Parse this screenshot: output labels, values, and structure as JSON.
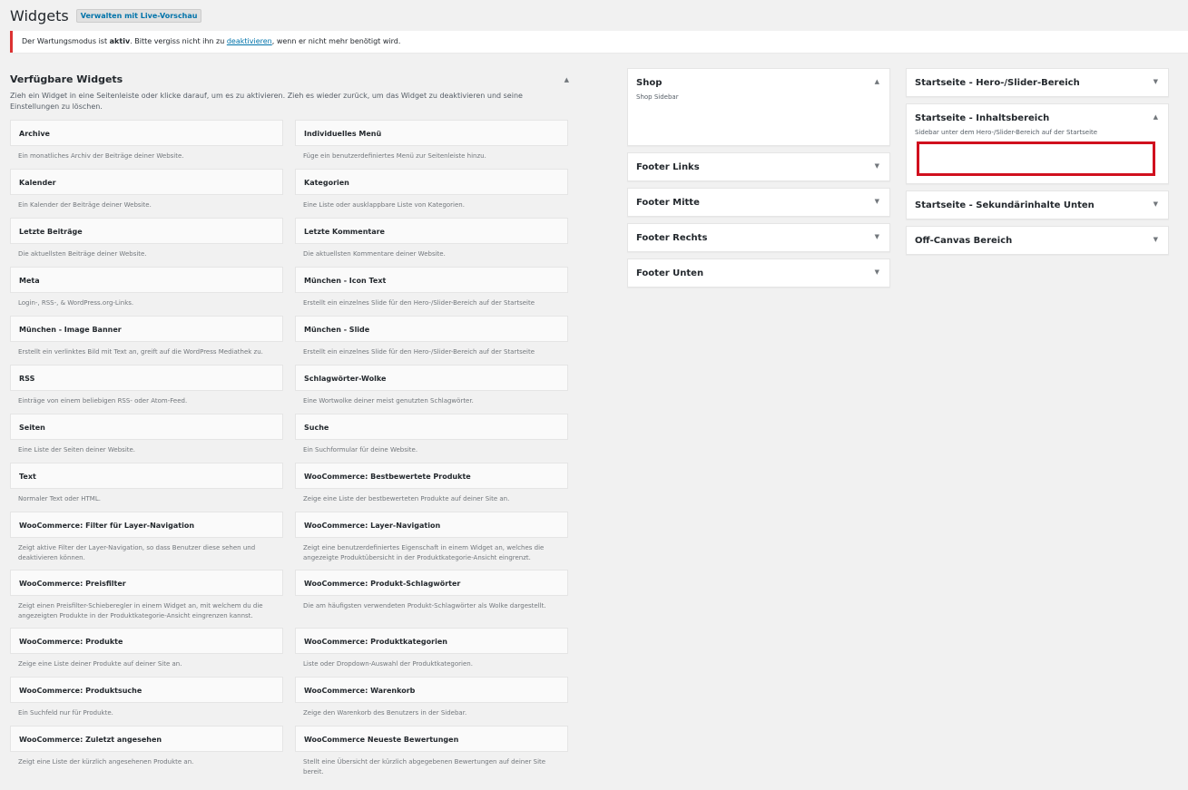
{
  "header": {
    "title": "Widgets",
    "live_preview": "Verwalten mit Live-Vorschau"
  },
  "notice": {
    "before": "Der Wartungsmodus ist ",
    "bold": "aktiv",
    "middle": ". Bitte vergiss nicht ihn zu ",
    "link": "deaktivieren",
    "after": ", wenn er nicht mehr benötigt wird."
  },
  "available": {
    "title": "Verfügbare Widgets",
    "toggle": "▲",
    "desc": "Zieh ein Widget in eine Seitenleiste oder klicke darauf, um es zu aktivieren. Zieh es wieder zurück, um das Widget zu deaktivieren und seine Einstellungen zu löschen.",
    "widgets": [
      {
        "title": "Archive",
        "desc": "Ein monatliches Archiv der Beiträge deiner Website."
      },
      {
        "title": "Individuelles Menü",
        "desc": "Füge ein benutzerdefiniertes Menü zur Seitenleiste hinzu."
      },
      {
        "title": "Kalender",
        "desc": "Ein Kalender der Beiträge deiner Website."
      },
      {
        "title": "Kategorien",
        "desc": "Eine Liste oder ausklappbare Liste von Kategorien."
      },
      {
        "title": "Letzte Beiträge",
        "desc": "Die aktuellsten Beiträge deiner Website."
      },
      {
        "title": "Letzte Kommentare",
        "desc": "Die aktuellsten Kommentare deiner Website."
      },
      {
        "title": "Meta",
        "desc": "Login-, RSS-, & WordPress.org-Links."
      },
      {
        "title": "München - Icon Text",
        "desc": "Erstellt ein einzelnes Slide für den Hero-/Slider-Bereich auf der Startseite"
      },
      {
        "title": "München - Image Banner",
        "desc": "Erstellt ein verlinktes Bild mit Text an, greift auf die WordPress Mediathek zu."
      },
      {
        "title": "München - Slide",
        "desc": "Erstellt ein einzelnes Slide für den Hero-/Slider-Bereich auf der Startseite"
      },
      {
        "title": "RSS",
        "desc": "Einträge von einem beliebigen RSS- oder Atom-Feed."
      },
      {
        "title": "Schlagwörter-Wolke",
        "desc": "Eine Wortwolke deiner meist genutzten Schlagwörter."
      },
      {
        "title": "Seiten",
        "desc": "Eine Liste der Seiten deiner Website."
      },
      {
        "title": "Suche",
        "desc": "Ein Suchformular für deine Website."
      },
      {
        "title": "Text",
        "desc": "Normaler Text oder HTML."
      },
      {
        "title": "WooCommerce: Bestbewertete Produkte",
        "desc": "Zeige eine Liste der bestbewerteten Produkte auf deiner Site an."
      },
      {
        "title": "WooCommerce: Filter für Layer-Navigation",
        "desc": "Zeigt aktive Filter der Layer-Navigation, so dass Benutzer diese sehen und deaktivieren können."
      },
      {
        "title": "WooCommerce: Layer-Navigation",
        "desc": "Zeigt eine benutzerdefiniertes Eigenschaft in einem Widget an, welches die angezeigte Produktübersicht in der Produktkategorie-Ansicht eingrenzt."
      },
      {
        "title": "WooCommerce: Preisfilter",
        "desc": "Zeigt einen Preisfilter-Schieberegler in einem Widget an, mit welchem du die angezeigten Produkte in der Produktkategorie-Ansicht eingrenzen kannst."
      },
      {
        "title": "WooCommerce: Produkt-Schlagwörter",
        "desc": "Die am häufigsten verwendeten Produkt-Schlagwörter als Wolke dargestellt."
      },
      {
        "title": "WooCommerce: Produkte",
        "desc": "Zeige eine Liste deiner Produkte auf deiner Site an."
      },
      {
        "title": "WooCommerce: Produktkategorien",
        "desc": "Liste oder Dropdown-Auswahl der Produktkategorien."
      },
      {
        "title": "WooCommerce: Produktsuche",
        "desc": "Ein Suchfeld nur für Produkte."
      },
      {
        "title": "WooCommerce: Warenkorb",
        "desc": "Zeige den Warenkorb des Benutzers in der Sidebar."
      },
      {
        "title": "WooCommerce: Zuletzt angesehen",
        "desc": "Zeigt eine Liste der kürzlich angesehenen Produkte an."
      },
      {
        "title": "WooCommerce Neueste Bewertungen",
        "desc": "Stellt eine Übersicht der kürzlich abgegebenen Bewertungen auf deiner Site bereit."
      }
    ]
  },
  "sidebars_middle": [
    {
      "title": "Shop",
      "desc": "Shop Sidebar",
      "toggle": "▲"
    },
    {
      "title": "Footer Links",
      "toggle": "▼"
    },
    {
      "title": "Footer Mitte",
      "toggle": "▼"
    },
    {
      "title": "Footer Rechts",
      "toggle": "▼"
    },
    {
      "title": "Footer Unten",
      "toggle": "▼"
    }
  ],
  "sidebars_right": [
    {
      "title": "Startseite - Hero-/Slider-Bereich",
      "toggle": "▼"
    },
    {
      "title": "Startseite - Inhaltsbereich",
      "desc": "Sidebar unter dem Hero-/Slider-Bereich auf der Startseite",
      "toggle": "▲"
    },
    {
      "title": "Startseite - Sekundärinhalte Unten",
      "toggle": "▼"
    },
    {
      "title": "Off-Canvas Bereich",
      "toggle": "▼"
    }
  ],
  "colors": {
    "accent": "#0073aa",
    "notice_border": "#dc3232",
    "drop_highlight": "#d0101e"
  }
}
